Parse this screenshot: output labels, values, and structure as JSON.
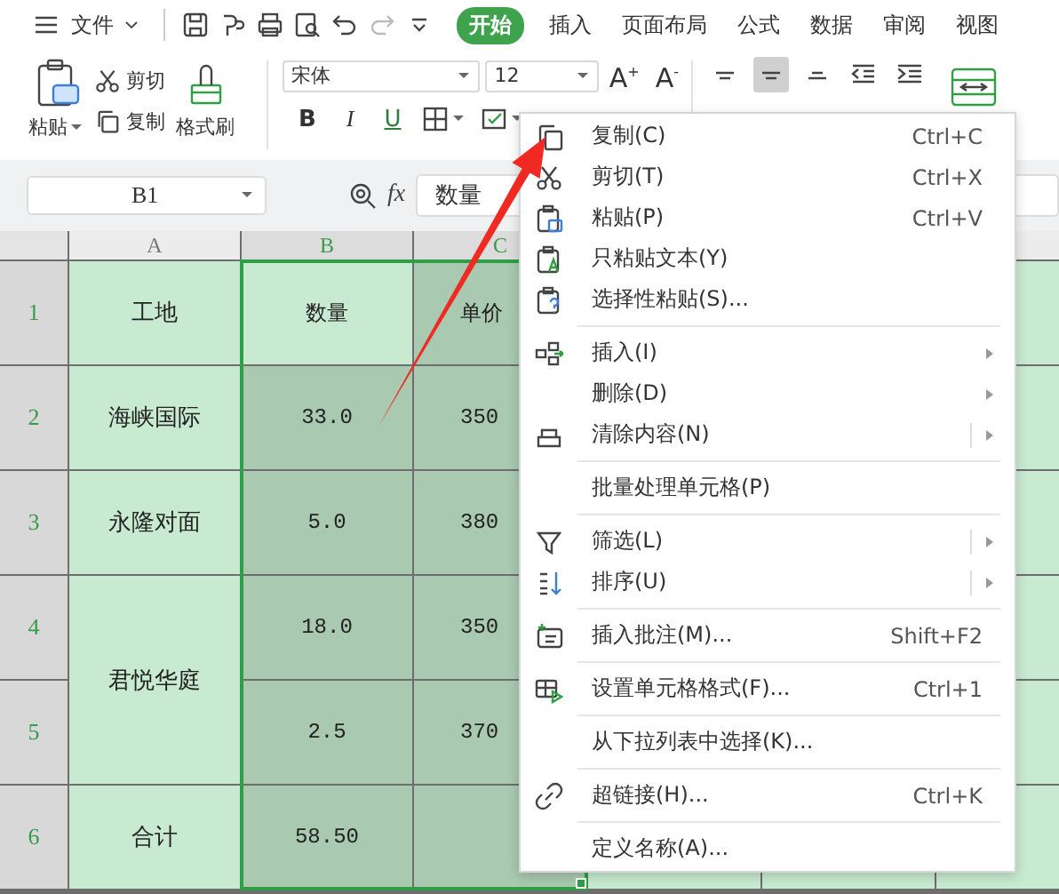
{
  "toolbar": {
    "file_menu": "文件",
    "redo_disabled": true,
    "tabs": [
      {
        "label": "开始",
        "selected": true
      },
      {
        "label": "插入",
        "selected": false
      },
      {
        "label": "页面布局",
        "selected": false
      },
      {
        "label": "公式",
        "selected": false
      },
      {
        "label": "数据",
        "selected": false
      },
      {
        "label": "审阅",
        "selected": false
      },
      {
        "label": "视图",
        "selected": false
      }
    ]
  },
  "ribbon": {
    "paste": "粘贴",
    "cut": "剪切",
    "copy": "复制",
    "format_painter": "格式刷",
    "font": "宋体",
    "font_size": "12",
    "font_grow": "A$^{+}$",
    "font_shrink": "A$^{-}$",
    "bold": "B",
    "italic": "I",
    "underline": "U",
    "vertical_align": [
      {
        "selected": false
      },
      {
        "selected": true
      },
      {
        "selected": false
      }
    ]
  },
  "formula_bar": {
    "cell_ref": "B1",
    "fx": "fx",
    "value": "数量"
  },
  "sheet": {
    "columns": [
      {
        "label": "A",
        "selected": false
      },
      {
        "label": "B",
        "selected": true
      },
      {
        "label": "C",
        "selected": true
      }
    ],
    "rows": [
      {
        "label": "1",
        "selected": true,
        "cells": [
          {
            "text": "工地",
            "selected": false
          },
          {
            "text": "数量",
            "selected": true,
            "active": true
          },
          {
            "text": "单价",
            "selected": true
          }
        ]
      },
      {
        "label": "2",
        "selected": true,
        "cells": [
          {
            "text": "海峡国际",
            "selected": false
          },
          {
            "text": "33.0",
            "selected": true
          },
          {
            "text": "350",
            "selected": true
          }
        ]
      },
      {
        "label": "3",
        "selected": true,
        "cells": [
          {
            "text": "永隆对面",
            "selected": false
          },
          {
            "text": "5.0",
            "selected": true
          },
          {
            "text": "380",
            "selected": true
          }
        ]
      },
      {
        "label": "4",
        "selected": true,
        "cells": [
          {
            "text": "君悦华庭",
            "selected": false
          },
          {
            "text": "18.0",
            "selected": true
          },
          {
            "text": "350",
            "selected": true
          }
        ]
      },
      {
        "label": "5",
        "selected": true,
        "cells": [
          {
            "merged": true
          },
          {
            "text": "2.5",
            "selected": true
          },
          {
            "text": "370",
            "selected": true
          }
        ]
      },
      {
        "label": "6",
        "selected": true,
        "cells": [
          {
            "text": "合计",
            "selected": false
          },
          {
            "text": "58.50",
            "selected": true
          },
          {
            "selected": true
          }
        ]
      }
    ]
  },
  "context_menu": [
    {
      "label": "复制(C)",
      "shortcut": "Ctrl+C"
    },
    {
      "label": "剪切(T)",
      "shortcut": "Ctrl+X"
    },
    {
      "label": "粘贴(P)",
      "shortcut": "Ctrl+V"
    },
    {
      "label": "只粘贴文本(Y)"
    },
    {
      "label": "选择性粘贴(S)..."
    },
    {
      "label": "插入(I)",
      "separator_before": true,
      "submenu": true
    },
    {
      "label": "删除(D)",
      "submenu": true
    },
    {
      "label": "清除内容(N)",
      "submenu": true,
      "split": true
    },
    {
      "label": "批量处理单元格(P)",
      "separator_before": true
    },
    {
      "label": "筛选(L)",
      "separator_before": true,
      "submenu": true,
      "split": true
    },
    {
      "label": "排序(U)",
      "submenu": true,
      "split": true
    },
    {
      "label": "插入批注(M)...",
      "separator_before": true,
      "shortcut": "Shift+F2"
    },
    {
      "label": "设置单元格格式(F)...",
      "separator_before": true,
      "shortcut": "Ctrl+1"
    },
    {
      "label": "从下拉列表中选择(K)...",
      "separator_before": true
    },
    {
      "label": "超链接(H)...",
      "separator_before": true,
      "shortcut": "Ctrl+K"
    },
    {
      "label": "定义名称(A)...",
      "separator_before": true
    }
  ]
}
